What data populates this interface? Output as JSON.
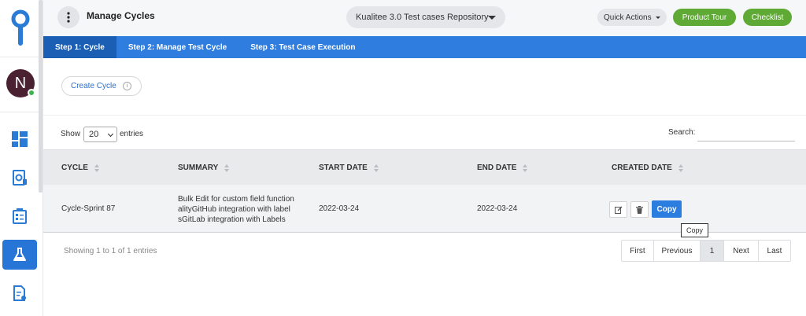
{
  "header": {
    "title": "Manage Cycles",
    "repository": "Kualitee 3.0 Test cases Repository",
    "quick_actions": "Quick Actions",
    "product_tour": "Product Tour",
    "checklist": "Checklist"
  },
  "sidebar": {
    "avatar_initial": "N",
    "items": [
      "dashboard-icon",
      "settings-doc-icon",
      "test-cases-icon",
      "flask-icon",
      "report-icon"
    ]
  },
  "steps": [
    "Step 1: Cycle",
    "Step 2: Manage Test Cycle",
    "Step 3: Test Case Execution"
  ],
  "toolbar": {
    "create_cycle": "Create Cycle",
    "info": "i"
  },
  "table_controls": {
    "show": "Show",
    "length_value": "20",
    "entries": "entries",
    "search_label": "Search:",
    "search_value": ""
  },
  "table": {
    "columns": [
      "CYCLE",
      "SUMMARY",
      "START DATE",
      "END DATE",
      "CREATED DATE"
    ],
    "rows": [
      {
        "cycle": "Cycle-Sprint 87",
        "summary_lines": [
          "Bulk Edit for custom field function",
          "alityGitHub integration with label",
          "sGitLab integration with Labels"
        ],
        "start_date": "2022-03-24",
        "end_date": "2022-03-24",
        "actions": {
          "edit": "edit-icon",
          "delete": "trash-icon",
          "copy": "Copy"
        }
      }
    ]
  },
  "tooltip": "Copy",
  "footer": {
    "info": "Showing 1 to 1 of 1 entries",
    "pager": {
      "first": "First",
      "previous": "Previous",
      "page": "1",
      "next": "Next",
      "last": "Last"
    }
  },
  "colors": {
    "primary": "#2f7dde",
    "active_step": "#1b5fb5",
    "green": "#5fa935",
    "avatar": "#4a2131"
  }
}
